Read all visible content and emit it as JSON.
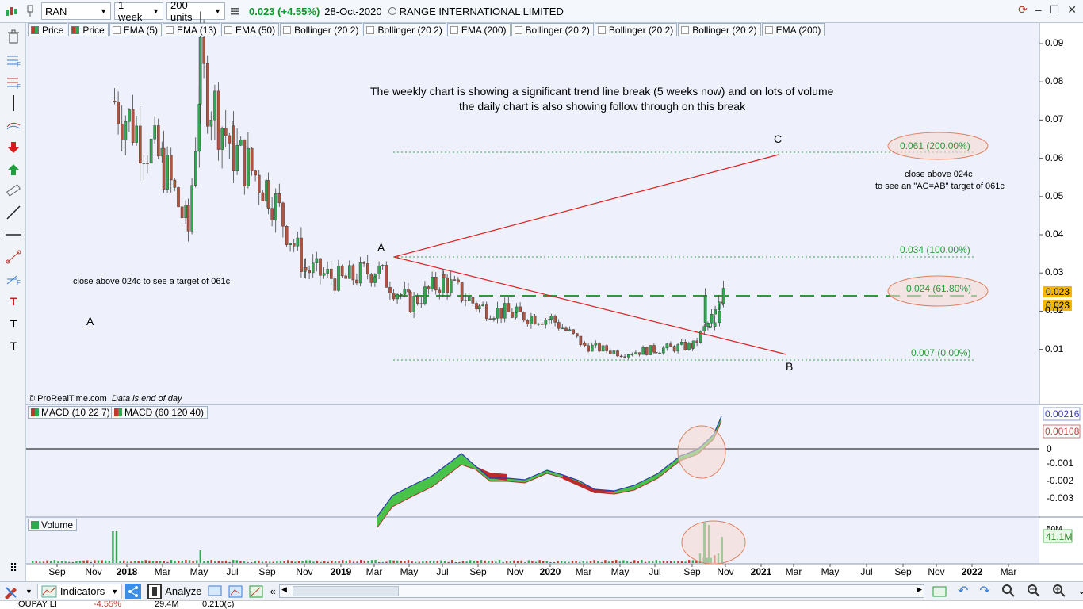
{
  "toolbar": {
    "ticker": "RAN",
    "period": "1 week",
    "units": "200 units",
    "price": "0.023",
    "change": "(+4.55%)",
    "date": "28-Oct-2020",
    "name": "RANGE INTERNATIONAL LIMITED"
  },
  "indicator_tabs": [
    "Price",
    "Price",
    "EMA (5)",
    "EMA (13)",
    "EMA (50)",
    "Bollinger (20 2)",
    "Bollinger (20 2)",
    "EMA (200)",
    "Bollinger (20 2)",
    "Bollinger (20 2)",
    "Bollinger (20 2)",
    "EMA (200)"
  ],
  "price_axis": [
    "0.09",
    "0.08",
    "0.07",
    "0.06",
    "0.05",
    "0.04",
    "0.03",
    "0.02",
    "0.01"
  ],
  "price_labels": [
    "0.023",
    "0.023"
  ],
  "annotations": {
    "main_text_1": "The weekly chart is showing a significant trend line break (5 weeks now) and on lots of volume",
    "main_text_2": "the daily chart is also showing follow through on this break",
    "target_1": "close above 024c",
    "target_2": "to see an \"AC=AB\" target of 061c",
    "left_text": "close above 024c to see a target of 061c",
    "label_a_left": "A",
    "label_a": "A",
    "label_b": "B",
    "label_c": "C",
    "fib_200": "0.061 (200.00%)",
    "fib_100": "0.034 (100.00%)",
    "fib_618": "0.024 (61.80%)",
    "fib_0": "0.007 (0.00%)",
    "source": "© ProRealTime.com",
    "source_note": "Data is end of day"
  },
  "macd": {
    "tab1": "MACD (10 22 7)",
    "tab2": "MACD (60 120 40)",
    "axis": [
      "0",
      "-0.001",
      "-0.002",
      "-0.003"
    ],
    "value1": "0.00216",
    "value2": "0.00108"
  },
  "volume": {
    "tab": "Volume",
    "axis_top": "50M",
    "value": "41.1M"
  },
  "time_axis": [
    "Sep",
    "Nov",
    "2018",
    "Mar",
    "May",
    "Jul",
    "Sep",
    "Nov",
    "2019",
    "Mar",
    "May",
    "Jul",
    "Sep",
    "Nov",
    "2020",
    "Mar",
    "May",
    "Jul",
    "Sep",
    "Nov",
    "2021",
    "Mar",
    "May",
    "Jul",
    "Sep",
    "Nov",
    "2022",
    "Mar"
  ],
  "bottombar": {
    "indicators": "Indicators",
    "analyze": "Analyze"
  },
  "statusbar": [
    "IOUPAY LI",
    "-4.55%",
    "29.4M",
    "0.210(c)"
  ],
  "chart_data": {
    "type": "candlestick",
    "title": "RANGE INTERNATIONAL LIMITED",
    "period": "weekly",
    "ylim": [
      0,
      0.095
    ],
    "close_series_approx": [
      {
        "x": "2017-12",
        "y": 0.075
      },
      {
        "x": "2018-02",
        "y": 0.058
      },
      {
        "x": "2018-04",
        "y": 0.041
      },
      {
        "x": "2018-05",
        "y": 0.082
      },
      {
        "x": "2018-07",
        "y": 0.062
      },
      {
        "x": "2018-09",
        "y": 0.052
      },
      {
        "x": "2018-11",
        "y": 0.031
      },
      {
        "x": "2019-01",
        "y": 0.028
      },
      {
        "x": "2019-03",
        "y": 0.031
      },
      {
        "x": "2019-05",
        "y": 0.022
      },
      {
        "x": "2019-07",
        "y": 0.028
      },
      {
        "x": "2019-09",
        "y": 0.021
      },
      {
        "x": "2019-11",
        "y": 0.019
      },
      {
        "x": "2020-01",
        "y": 0.018
      },
      {
        "x": "2020-03",
        "y": 0.011
      },
      {
        "x": "2020-05",
        "y": 0.009
      },
      {
        "x": "2020-07",
        "y": 0.01
      },
      {
        "x": "2020-09",
        "y": 0.011
      },
      {
        "x": "2020-10",
        "y": 0.023
      }
    ]
  }
}
